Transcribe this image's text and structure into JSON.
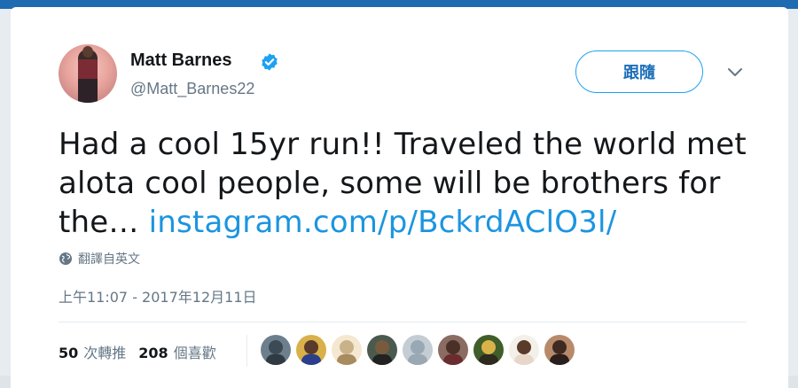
{
  "author": {
    "name": "Matt Barnes",
    "handle": "@Matt_Barnes22",
    "verified": true
  },
  "follow_button": {
    "label": "跟隨"
  },
  "tweet": {
    "text": "Had a cool 15yr run!! Traveled the world met alota cool people, some will be brothers for the…",
    "link": "instagram.com/p/BckrdAClO3l/"
  },
  "translate_label": "翻譯自英文",
  "timestamp": "上午11:07 - 2017年12月11日",
  "stats": {
    "retweets_count": "50",
    "retweets_label": "次轉推",
    "likes_count": "208",
    "likes_label": "個喜歡"
  },
  "likers": [
    {
      "bg": "#6d7f8c",
      "head": "#3b4a55",
      "body": "#2f3a42"
    },
    {
      "bg": "#d9b04a",
      "head": "#5a3a2a",
      "body": "#2b3f8c"
    },
    {
      "bg": "#f5e8d0",
      "head": "#c9b28a",
      "body": "#a88b5f"
    },
    {
      "bg": "#4b5a4f",
      "head": "#7a5a3e",
      "body": "#222222"
    },
    {
      "bg": "#c4cdd4",
      "head": "#9aa8b3",
      "body": "#9aa8b3"
    },
    {
      "bg": "#8a6c62",
      "head": "#4a3026",
      "body": "#6b2c30"
    },
    {
      "bg": "#3f5e2a",
      "head": "#d9b34a",
      "body": "#2d2a1f"
    },
    {
      "bg": "#f3efe9",
      "head": "#5a3a28",
      "body": "#e8d7c8"
    },
    {
      "bg": "#b88a6a",
      "head": "#3f2a22",
      "body": "#2a1f1d"
    }
  ],
  "colors": {
    "accent": "#1da1f2",
    "link": "#1b95e0",
    "secondary_text": "#657786",
    "primary_text": "#14171a"
  },
  "icons": {
    "verified": "verified-badge-icon",
    "globe": "globe-icon",
    "chevron": "chevron-down-icon"
  }
}
